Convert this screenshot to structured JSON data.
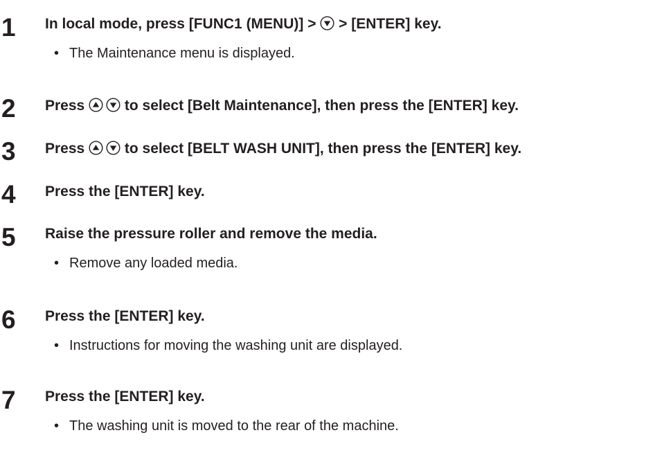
{
  "steps": [
    {
      "number": "1",
      "parts": {
        "a": "In local mode, press [FUNC1 (MENU)] > ",
        "b": " > [ENTER] key."
      },
      "note": "The Maintenance menu is displayed."
    },
    {
      "number": "2",
      "parts": {
        "a": "Press ",
        "b": " to select [Belt Maintenance], then press the [ENTER] key."
      }
    },
    {
      "number": "3",
      "parts": {
        "a": "Press ",
        "b": " to select [BELT WASH UNIT], then press the [ENTER] key."
      }
    },
    {
      "number": "4",
      "text": "Press the [ENTER] key."
    },
    {
      "number": "5",
      "text": "Raise the pressure roller and remove the media.",
      "note": "Remove any loaded media."
    },
    {
      "number": "6",
      "text": "Press the [ENTER] key.",
      "note": "Instructions for moving the washing unit are displayed."
    },
    {
      "number": "7",
      "text": "Press the [ENTER] key.",
      "note": "The washing unit is moved to the rear of the machine."
    }
  ],
  "bullet": "•",
  "icons": {
    "up": "up-arrow-circle-icon",
    "down": "down-arrow-circle-icon"
  },
  "colors": {
    "text": "#231f20"
  }
}
